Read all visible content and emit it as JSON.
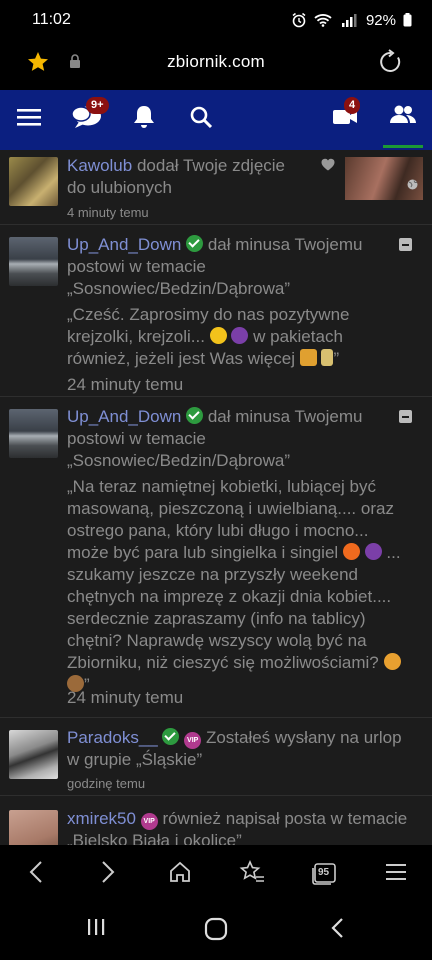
{
  "status_bar": {
    "time": "11:02",
    "battery": "92%"
  },
  "browser": {
    "url": "zbiornik.com",
    "tabs_count": "95"
  },
  "nav": {
    "messages_badge": "9+",
    "videos_badge": "4"
  },
  "feed": [
    {
      "user": "Kawolub",
      "action": "dodał Twoje zdjęcie do ulubionych",
      "time": "4 minuty temu"
    },
    {
      "user": "Up_And_Down",
      "action": "dał minusa Twojemu postowi w temacie „Sosnowiec/Bedzin/Dąbrowa”",
      "quote_part1": "„Cześć. Zaprosimy do nas pozytywne krejzolki, krejzoli...",
      "quote_part2": "w pakietach również, jeżeli jest Was więcej",
      "quote_end": "”",
      "time": "24 minuty temu"
    },
    {
      "user": "Up_And_Down",
      "action": "dał minusa Twojemu postowi w temacie „Sosnowiec/Bedzin/Dąbrowa”",
      "quote_part1": "„Na teraz namiętnej kobietki, lubiącej być masowaną, pieszczoną i uwielbianą.... oraz ostrego pana, który lubi długo i mocno... może być para lub singielka i singiel",
      "quote_part2": "... szukamy jeszcze na przyszły weekend chętnych na imprezę z okazji dnia kobiet.... serdecznie zapraszamy (info na tablicy) chętni? Naprawdę wszyscy wolą być na Zbiorniku, niż cieszyć się możliwościami?",
      "quote_end": "”",
      "time": "24 minuty temu"
    },
    {
      "user": "Paradoks__",
      "action": "Zostałeś wysłany na urlop w grupie „Śląskie”",
      "time": "godzinę temu"
    },
    {
      "user": "xmirek50",
      "action": "również napisał posta w temacie „Bielsko Biała i okolice”"
    }
  ],
  "vip_label": "VIP",
  "colors": {
    "nav_bg": "#0b1f80",
    "link": "#7f8fd4",
    "feed_bg": "#1c1c1c",
    "check": "#2d9a3f",
    "badge": "#8b1010"
  }
}
